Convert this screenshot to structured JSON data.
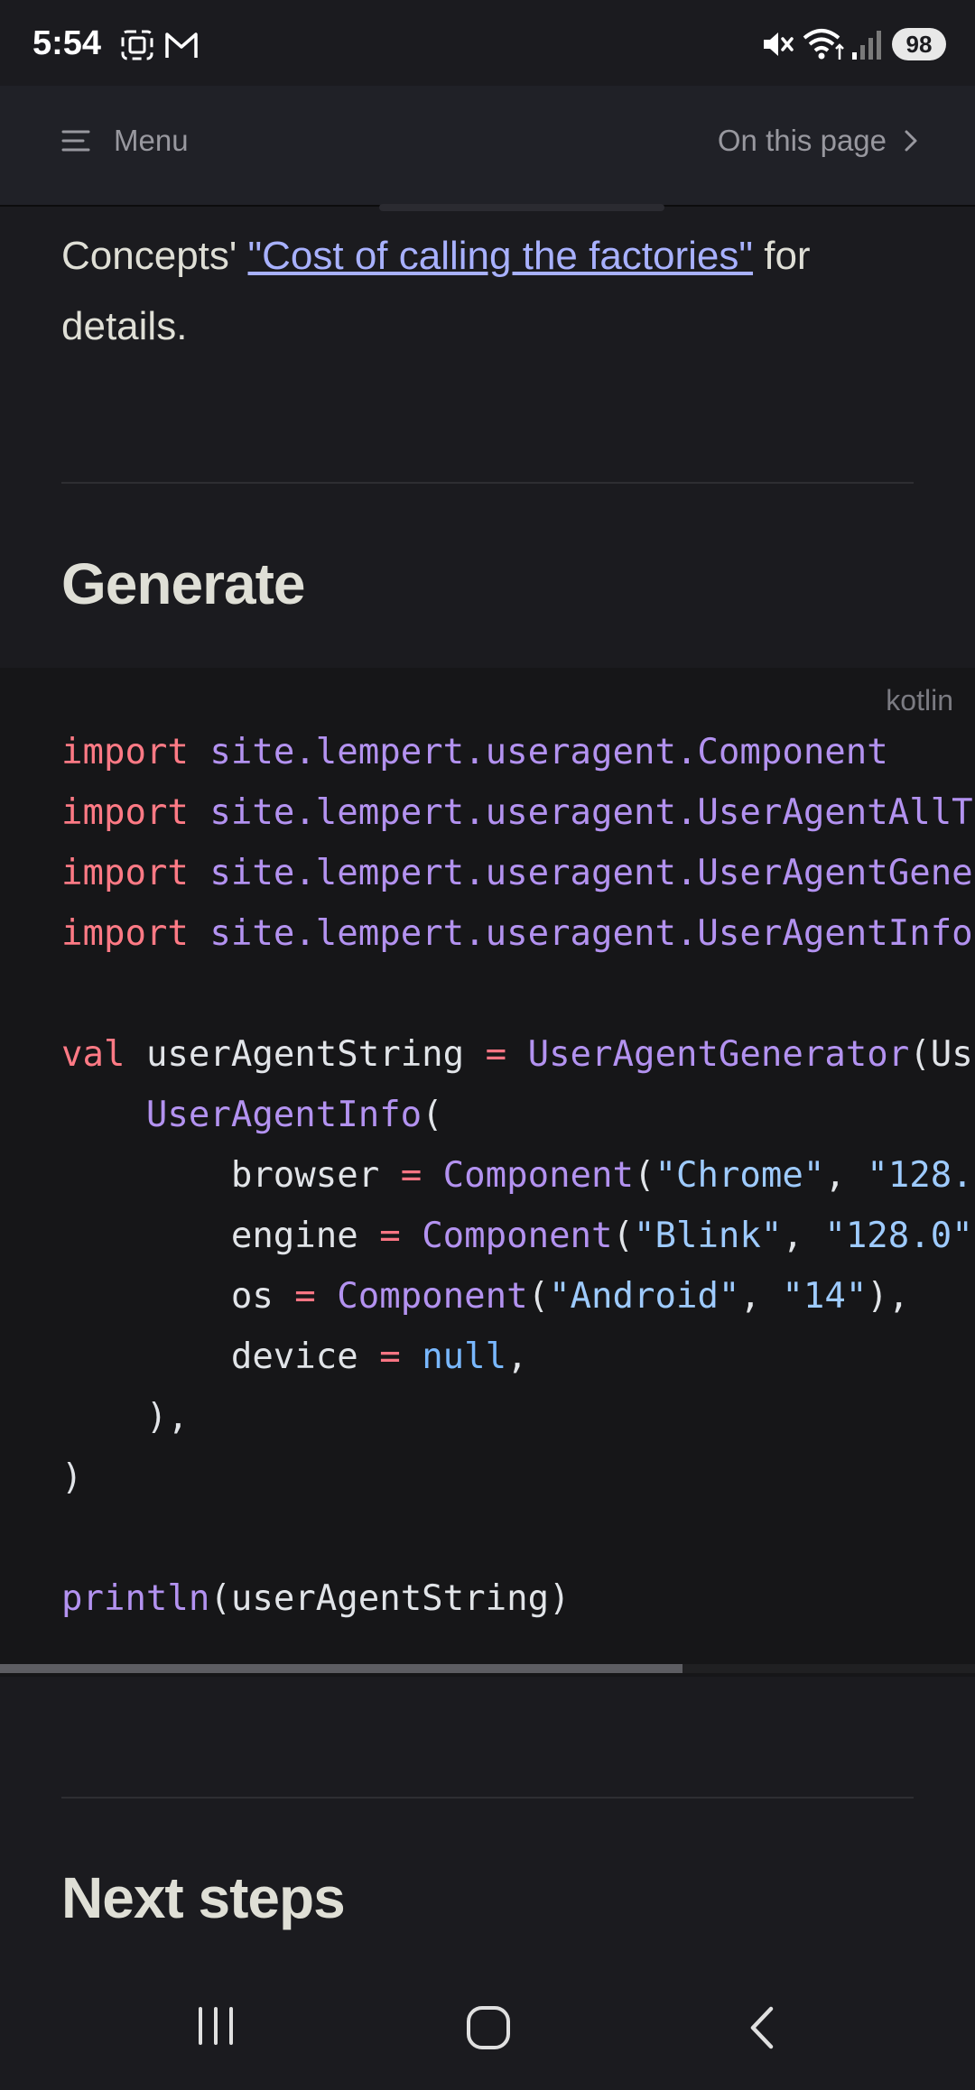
{
  "status_bar": {
    "time": "5:54",
    "left_icons": [
      "screenshot-icon",
      "gmail-icon"
    ],
    "right_icons": [
      "mute-icon",
      "wifi-icon",
      "signal-icon"
    ],
    "battery": "98"
  },
  "nav": {
    "menu_label": "Menu",
    "on_this_page_label": "On this page"
  },
  "content": {
    "intro_prefix": "Concepts' ",
    "intro_link": "\"Cost of calling the factories\"",
    "intro_suffix": " for details.",
    "heading_generate": "Generate",
    "heading_next_steps": "Next steps"
  },
  "code_block": {
    "language": "kotlin",
    "scroll_fraction_visible": 0.7
  },
  "code_tokens": {
    "import": "import",
    "pkg_component": "site.lempert.useragent.Component",
    "pkg_alltypes": "site.lempert.useragent.UserAgentAllT",
    "pkg_generator": "site.lempert.useragent.UserAgentGene",
    "pkg_info": "site.lempert.useragent.UserAgentInfo",
    "val": "val",
    "user_agent_string": "userAgentString",
    "eq": "=",
    "generator_call": "UserAgentGenerator",
    "generator_rest": "(Us",
    "user_agent_info": "UserAgentInfo",
    "browser": "browser",
    "engine": "engine",
    "os": "os",
    "device": "device",
    "component": "Component",
    "chrome": "\"Chrome\"",
    "chrome_ver": "\"128.",
    "blink": "\"Blink\"",
    "blink_ver": "\"128.0\"",
    "android": "\"Android\"",
    "android_ver": "\"14\"",
    "null": "null",
    "println": "println",
    "println_arg": "(userAgentString)"
  },
  "system_nav": {
    "buttons": [
      "recents-icon",
      "home-icon",
      "back-icon"
    ]
  }
}
